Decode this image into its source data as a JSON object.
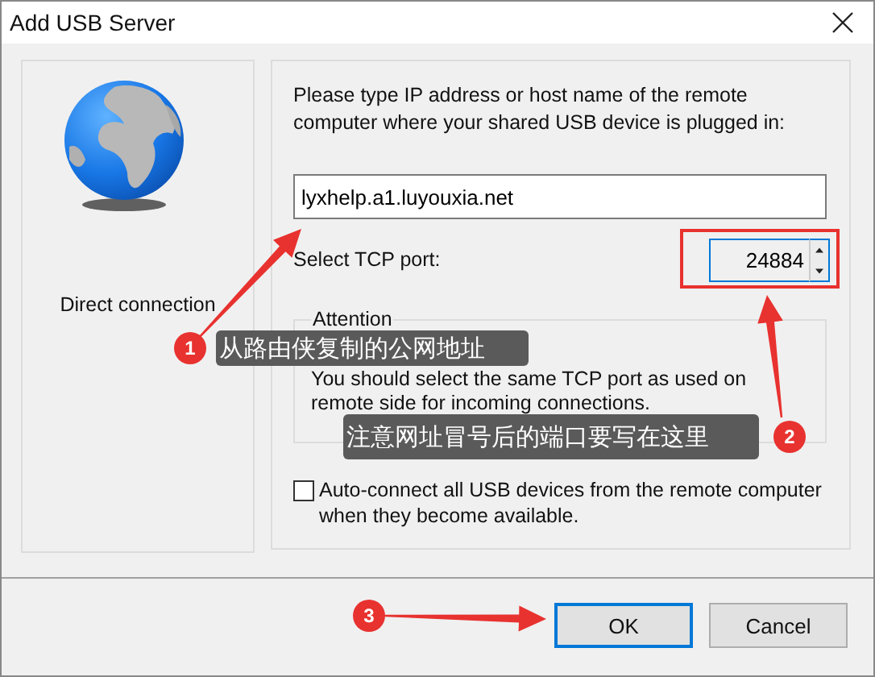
{
  "window": {
    "title": "Add USB Server"
  },
  "connection": {
    "label": "Direct connection"
  },
  "prompt": "Please type IP address or host name of the remote computer where your shared USB device is plugged in:",
  "host": {
    "value": "lyxhelp.a1.luyouxia.net"
  },
  "port": {
    "label": "Select TCP port:",
    "value": "24884",
    "highlighted": true
  },
  "attention": {
    "title": "Attention",
    "text": "You should select the same TCP port as used on remote side for incoming connections."
  },
  "auto_connect": {
    "label": "Auto-connect all USB devices from the remote computer when they become available.",
    "checked": false
  },
  "buttons": [
    {
      "label": "OK",
      "default": true
    },
    {
      "label": "Cancel",
      "default": false
    }
  ],
  "annotations": [
    {
      "number": "1",
      "text": "从路由侠复制的公网地址"
    },
    {
      "number": "2",
      "text": "注意网址冒号后的端口要写在这里"
    },
    {
      "number": "3"
    }
  ]
}
